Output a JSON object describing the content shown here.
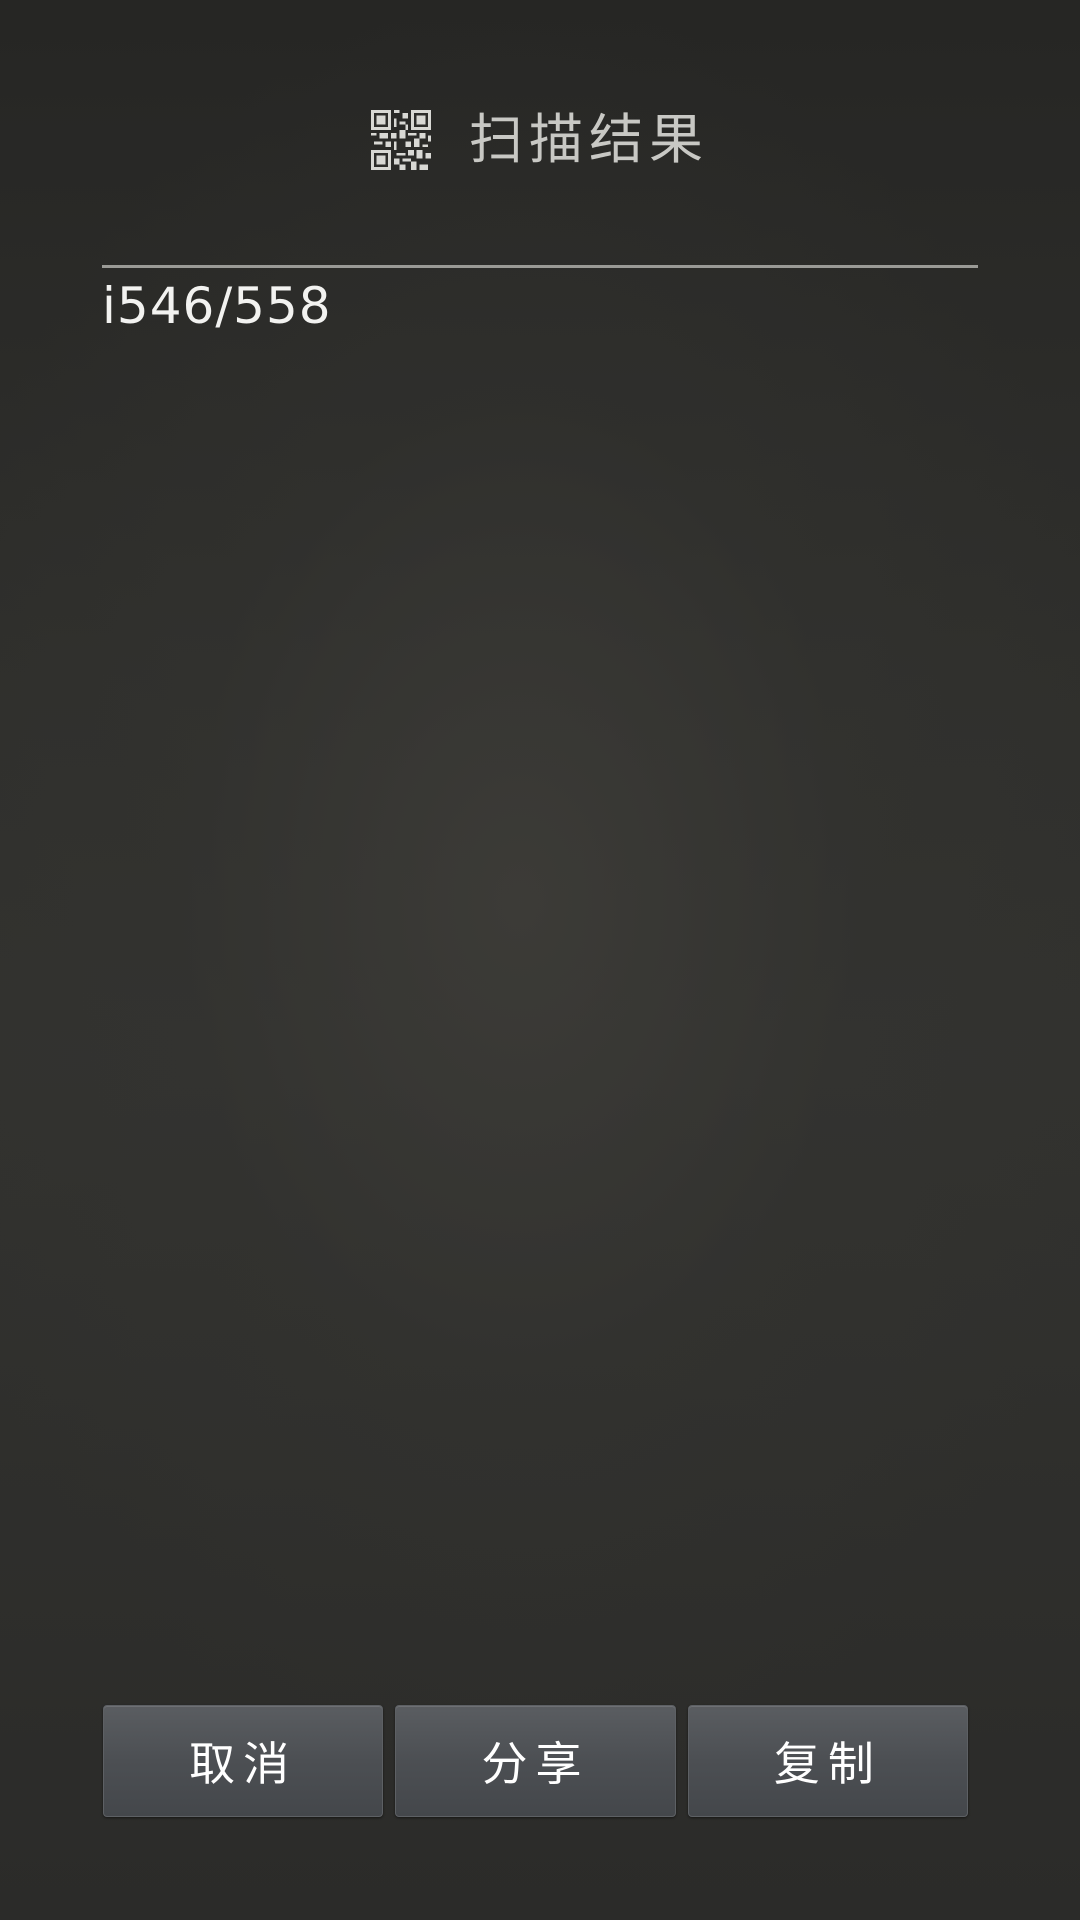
{
  "header": {
    "icon": "qr-code-icon",
    "title": "扫描结果"
  },
  "result": {
    "text": "i546/558"
  },
  "buttons": {
    "cancel_label": "取消",
    "share_label": "分享",
    "copy_label": "复制"
  },
  "colors": {
    "background": "#2f2f2c",
    "title_text": "#c8c8c4",
    "divider": "#9a9a96",
    "button": "#4c4f53"
  }
}
